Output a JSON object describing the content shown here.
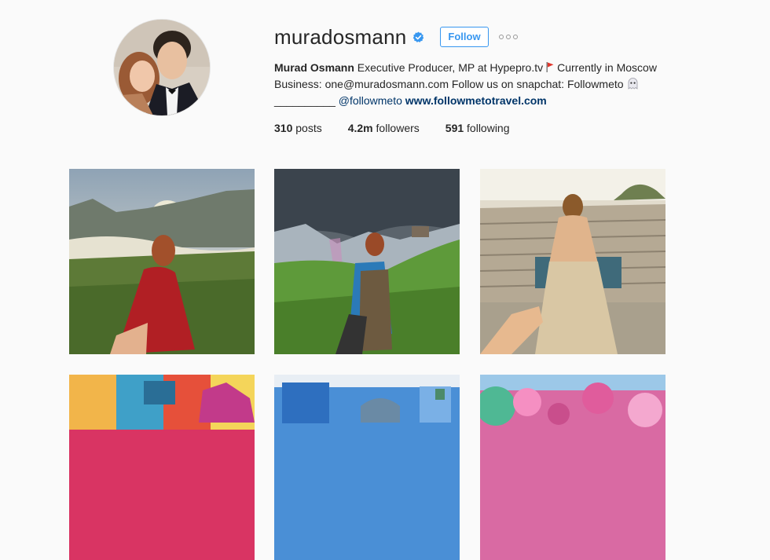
{
  "profile": {
    "username": "muradosmann",
    "verified": true,
    "follow_label": "Follow",
    "full_name": "Murad Osmann",
    "bio_line1": "Executive Producer, MP at Hypepro.tv",
    "bio_line1b": "Currently in Moscow",
    "bio_line2": "Business: one@muradosmann.com Follow us on snapchat: Followmeto",
    "bio_line3_prefix": "__________",
    "bio_handle": "@followmeto",
    "bio_link": "www.followmetotravel.com"
  },
  "stats": {
    "posts_count": "310",
    "posts_label": "posts",
    "followers_count": "4.2m",
    "followers_label": "followers",
    "following_count": "591",
    "following_label": "following"
  },
  "colors": {
    "accent": "#3897f0",
    "link": "#003569",
    "background": "#fafafa"
  },
  "icons": [
    "verified-badge-icon",
    "more-options-icon",
    "red-flag-icon",
    "ghost-icon"
  ]
}
